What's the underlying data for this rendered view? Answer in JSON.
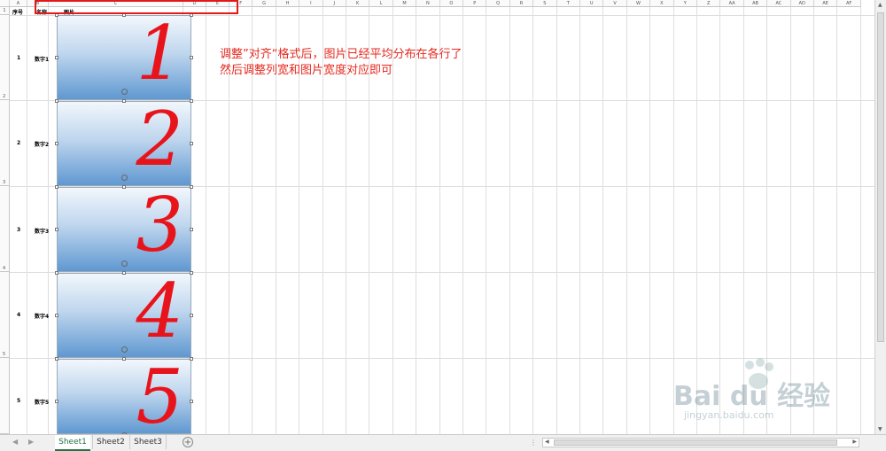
{
  "columns": [
    "A",
    "B",
    "C",
    "D",
    "E",
    "F",
    "G",
    "H",
    "I",
    "J",
    "K",
    "L",
    "M",
    "N",
    "O",
    "P",
    "Q",
    "R",
    "S",
    "T",
    "U",
    "V",
    "W",
    "X",
    "Y",
    "Z",
    "AA",
    "AB",
    "AC",
    "AD",
    "AE",
    "AF"
  ],
  "row_numbers": [
    "1",
    "2",
    "3",
    "4",
    "5"
  ],
  "header_row": {
    "seq": "序号",
    "name": "名称",
    "image": "图片"
  },
  "rows": [
    {
      "seq": "1",
      "name": "数字1",
      "digit": "1"
    },
    {
      "seq": "2",
      "name": "数字2",
      "digit": "2"
    },
    {
      "seq": "3",
      "name": "数字3",
      "digit": "3"
    },
    {
      "seq": "4",
      "name": "数字4",
      "digit": "4"
    },
    {
      "seq": "5",
      "name": "数字5",
      "digit": "5"
    }
  ],
  "annotation": {
    "line1": "调整”对齐“格式后，图片已经平均分布在各行了",
    "line2": "然后调整列宽和图片宽度对应即可"
  },
  "sheets": [
    "Sheet1",
    "Sheet2",
    "Sheet3"
  ],
  "active_sheet": "Sheet1",
  "watermark": {
    "brand": "Bai du 经验",
    "url": "jingyan.baidu.com"
  },
  "colors": {
    "accent": "#217346",
    "annotation_red": "#e6281e",
    "highlight_red": "#e01a1a"
  }
}
